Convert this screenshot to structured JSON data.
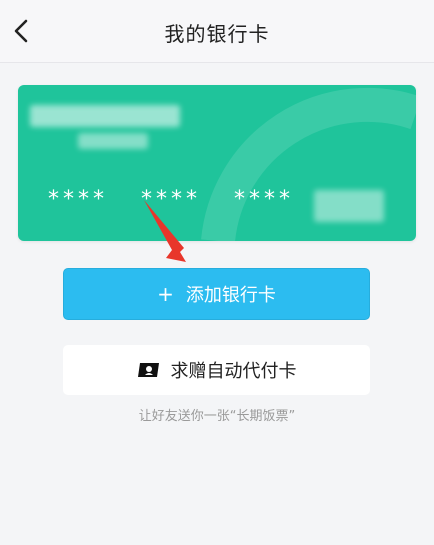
{
  "header": {
    "title": "我的银行卡"
  },
  "card": {
    "masked_groups": [
      "****",
      "****",
      "****"
    ]
  },
  "add_button": {
    "plus": "+",
    "label": "添加银行卡"
  },
  "gift_button": {
    "label": "求赠自动代付卡"
  },
  "hint": "让好友送你一张“长期饭票”",
  "colors": {
    "card": "#1fc49b",
    "primary": "#2cbcf0",
    "pointer": "#e8362b"
  }
}
